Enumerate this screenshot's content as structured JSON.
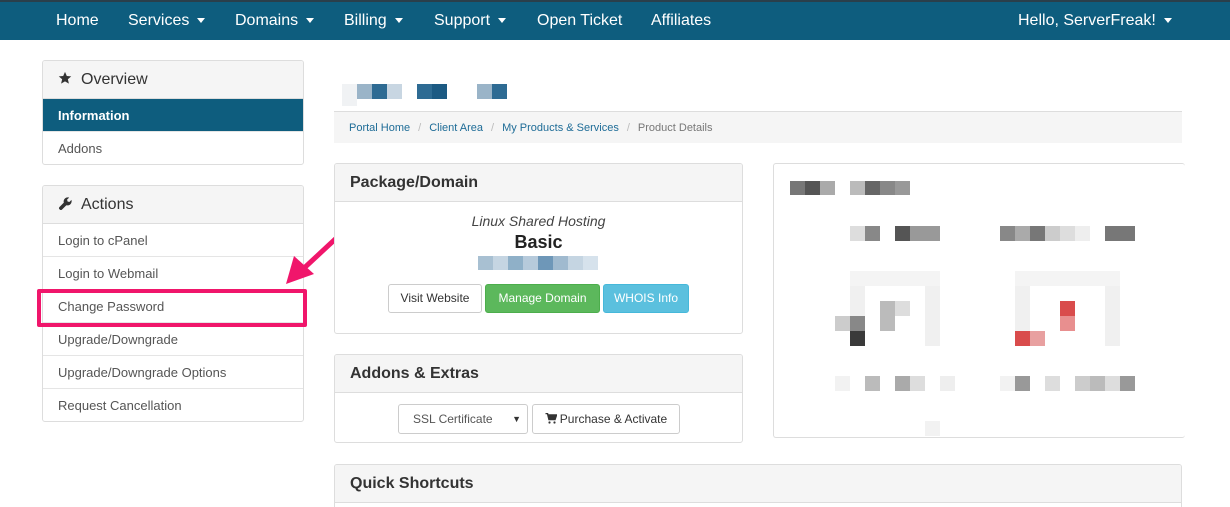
{
  "nav": {
    "items": [
      {
        "label": "Home",
        "dropdown": false
      },
      {
        "label": "Services",
        "dropdown": true
      },
      {
        "label": "Domains",
        "dropdown": true
      },
      {
        "label": "Billing",
        "dropdown": true
      },
      {
        "label": "Support",
        "dropdown": true
      },
      {
        "label": "Open Ticket",
        "dropdown": false
      },
      {
        "label": "Affiliates",
        "dropdown": false
      }
    ],
    "user_greeting": "Hello, ServerFreak!"
  },
  "sidebar": {
    "overview": {
      "title": "Overview",
      "icon": "star-icon",
      "items": [
        {
          "label": "Information",
          "active": true
        },
        {
          "label": "Addons",
          "active": false
        }
      ]
    },
    "actions": {
      "title": "Actions",
      "icon": "wrench-icon",
      "items": [
        {
          "label": "Login to cPanel"
        },
        {
          "label": "Login to Webmail"
        },
        {
          "label": "Change Password",
          "highlighted": true
        },
        {
          "label": "Upgrade/Downgrade"
        },
        {
          "label": "Upgrade/Downgrade Options"
        },
        {
          "label": "Request Cancellation"
        }
      ]
    }
  },
  "breadcrumb": {
    "items": [
      "Portal Home",
      "Client Area",
      "My Products & Services"
    ],
    "current": "Product Details"
  },
  "package": {
    "title": "Package/Domain",
    "group": "Linux Shared Hosting",
    "name": "Basic",
    "buttons": {
      "visit": "Visit Website",
      "manage": "Manage Domain",
      "whois": "WHOIS Info"
    }
  },
  "addons": {
    "title": "Addons & Extras",
    "select_value": "SSL Certificate",
    "purchase_label": "Purchase & Activate"
  },
  "shortcuts": {
    "title": "Quick Shortcuts"
  },
  "colors": {
    "nav_bg": "#0e5d7e",
    "active_bg": "#0e5d7e",
    "success": "#5cb85c",
    "info": "#5bc0de",
    "annotation": "#f0166b"
  }
}
